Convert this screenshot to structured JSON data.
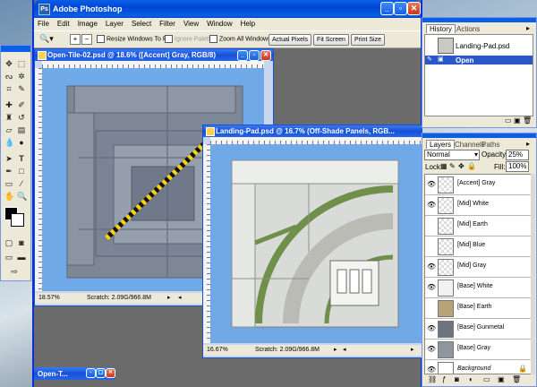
{
  "app": {
    "title": "Adobe Photoshop"
  },
  "menu": [
    "File",
    "Edit",
    "Image",
    "Layer",
    "Select",
    "Filter",
    "View",
    "Window",
    "Help"
  ],
  "options": {
    "resize_windows": "Resize Windows To Fit",
    "ignore_palettes": "Ignore Palettes",
    "zoom_all": "Zoom All Windows",
    "actual_pixels": "Actual Pixels",
    "fit_screen": "Fit Screen",
    "print_size": "Print Size"
  },
  "doc1": {
    "title": "Open-Tile-02.psd @ 18.6% ([Accent] Gray, RGB/8)",
    "zoom": "18.57%",
    "scratch": "Scratch: 2.09G/966.8M"
  },
  "doc2": {
    "title": "Landing-Pad.psd @ 16.7% (Off-Shade Panels, RGB...",
    "zoom": "16.67%",
    "scratch": "Scratch: 2.09G/966.8M"
  },
  "minimized": {
    "title": "Open-T..."
  },
  "history": {
    "tabs": [
      "History",
      "Actions"
    ],
    "snapshot": "Landing-Pad.psd",
    "state": "Open"
  },
  "layers": {
    "tabs": [
      "Layers",
      "Channels",
      "Paths"
    ],
    "blend": "Normal",
    "opacity_label": "Opacity:",
    "opacity": "25%",
    "lock_label": "Lock:",
    "fill_label": "Fill:",
    "fill": "100%",
    "items": [
      {
        "name": "[Accent] Gray",
        "visible": true
      },
      {
        "name": "[Mid] White",
        "visible": true
      },
      {
        "name": "[Mid] Earth",
        "visible": false
      },
      {
        "name": "[Mid] Blue",
        "visible": false
      },
      {
        "name": "[Mid] Gray",
        "visible": true
      },
      {
        "name": "[Base] White",
        "visible": true
      },
      {
        "name": "[Base] Earth",
        "visible": false
      },
      {
        "name": "[Base] Gunmetal",
        "visible": true
      },
      {
        "name": "[Base] Gray",
        "visible": true
      },
      {
        "name": "Background",
        "visible": true
      }
    ]
  },
  "colors": {
    "accent": "#0046d5",
    "canvas_bg": "#6fa9e8",
    "panel": "#ece9d8",
    "green": "#6f8f4a"
  }
}
